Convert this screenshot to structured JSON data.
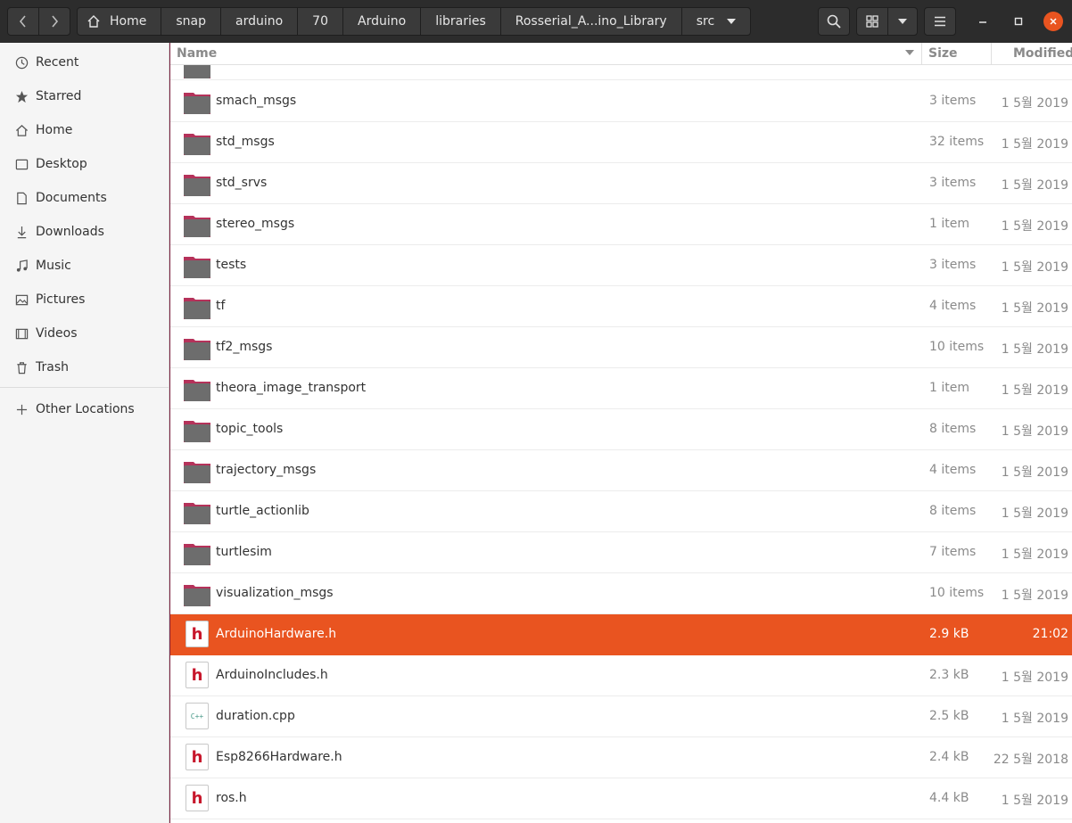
{
  "header": {
    "breadcrumbs": [
      "Home",
      "snap",
      "arduino",
      "70",
      "Arduino",
      "libraries",
      "Rosserial_A...ino_Library",
      "src"
    ]
  },
  "sidebar": {
    "items": [
      {
        "label": "Recent",
        "icon": "clock-icon"
      },
      {
        "label": "Starred",
        "icon": "star-icon"
      },
      {
        "label": "Home",
        "icon": "home-icon"
      },
      {
        "label": "Desktop",
        "icon": "desktop-icon"
      },
      {
        "label": "Documents",
        "icon": "document-icon"
      },
      {
        "label": "Downloads",
        "icon": "download-icon"
      },
      {
        "label": "Music",
        "icon": "music-icon"
      },
      {
        "label": "Pictures",
        "icon": "picture-icon"
      },
      {
        "label": "Videos",
        "icon": "video-icon"
      },
      {
        "label": "Trash",
        "icon": "trash-icon"
      }
    ],
    "other_locations": "Other Locations"
  },
  "columns": {
    "name": "Name",
    "size": "Size",
    "modified": "Modified"
  },
  "files": [
    {
      "name": "smach_msgs",
      "size": "3 items",
      "modified": "1 5월 2019",
      "type": "folder"
    },
    {
      "name": "std_msgs",
      "size": "32 items",
      "modified": "1 5월 2019",
      "type": "folder"
    },
    {
      "name": "std_srvs",
      "size": "3 items",
      "modified": "1 5월 2019",
      "type": "folder"
    },
    {
      "name": "stereo_msgs",
      "size": "1 item",
      "modified": "1 5월 2019",
      "type": "folder"
    },
    {
      "name": "tests",
      "size": "3 items",
      "modified": "1 5월 2019",
      "type": "folder"
    },
    {
      "name": "tf",
      "size": "4 items",
      "modified": "1 5월 2019",
      "type": "folder"
    },
    {
      "name": "tf2_msgs",
      "size": "10 items",
      "modified": "1 5월 2019",
      "type": "folder"
    },
    {
      "name": "theora_image_transport",
      "size": "1 item",
      "modified": "1 5월 2019",
      "type": "folder"
    },
    {
      "name": "topic_tools",
      "size": "8 items",
      "modified": "1 5월 2019",
      "type": "folder"
    },
    {
      "name": "trajectory_msgs",
      "size": "4 items",
      "modified": "1 5월 2019",
      "type": "folder"
    },
    {
      "name": "turtle_actionlib",
      "size": "8 items",
      "modified": "1 5월 2019",
      "type": "folder"
    },
    {
      "name": "turtlesim",
      "size": "7 items",
      "modified": "1 5월 2019",
      "type": "folder"
    },
    {
      "name": "visualization_msgs",
      "size": "10 items",
      "modified": "1 5월 2019",
      "type": "folder"
    },
    {
      "name": "ArduinoHardware.h",
      "size": "2.9 kB",
      "modified": "21:02",
      "type": "h",
      "selected": true
    },
    {
      "name": "ArduinoIncludes.h",
      "size": "2.3 kB",
      "modified": "1 5월 2019",
      "type": "h"
    },
    {
      "name": "duration.cpp",
      "size": "2.5 kB",
      "modified": "1 5월 2019",
      "type": "cpp"
    },
    {
      "name": "Esp8266Hardware.h",
      "size": "2.4 kB",
      "modified": "22 5월 2018",
      "type": "h"
    },
    {
      "name": "ros.h",
      "size": "4.4 kB",
      "modified": "1 5월 2019",
      "type": "h"
    }
  ],
  "file_icon_labels": {
    "h": "h",
    "cpp": "C++"
  },
  "colors": {
    "accent": "#e95420",
    "folder": "#6d6d6d",
    "folder_tab": "#b5325a",
    "header_bg": "#2c2c2c"
  }
}
